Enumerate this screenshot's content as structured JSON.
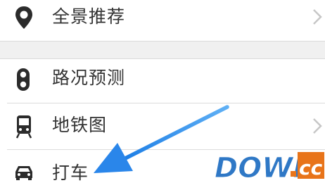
{
  "menu": {
    "items": [
      {
        "label": "全景推荐",
        "icon": "location-pin-icon"
      },
      {
        "label": "路况预测",
        "icon": "traffic-light-icon"
      },
      {
        "label": "地铁图",
        "icon": "subway-icon"
      },
      {
        "label": "打车",
        "icon": "taxi-car-icon"
      }
    ]
  },
  "annotation": {
    "arrow_color": "#3a8fe8",
    "watermark": "DOWN.cc"
  },
  "colors": {
    "text": "#333333",
    "icon": "#2b2b2b",
    "chevron": "#c7c7c7",
    "divider": "#dcdcdc",
    "section_gap": "#f0f0f0"
  }
}
